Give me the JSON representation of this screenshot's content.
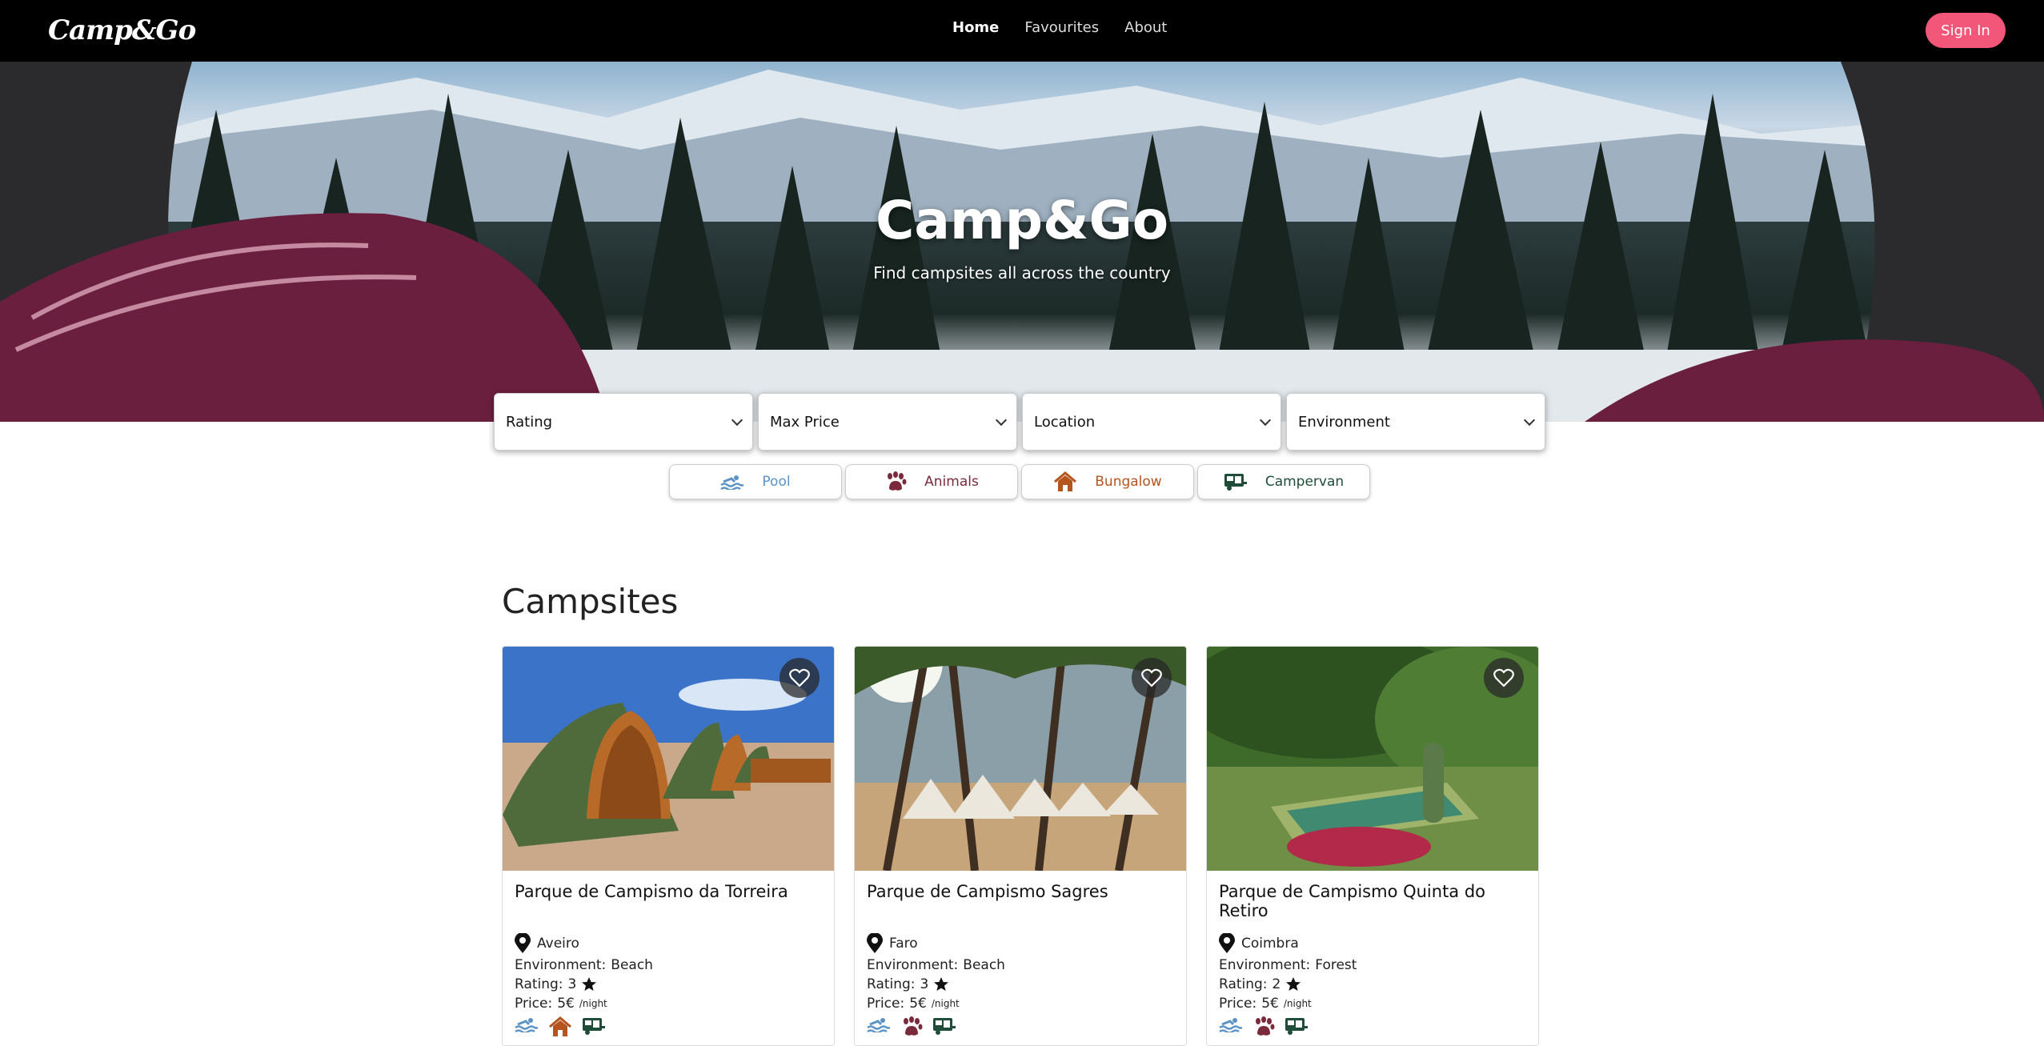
{
  "nav": {
    "logo": "Camp&Go",
    "links": [
      "Home",
      "Favourites",
      "About"
    ],
    "signin": "Sign In"
  },
  "hero": {
    "title": "Camp&Go",
    "subtitle": "Find campsites all across the country"
  },
  "filters": [
    "Rating",
    "Max Price",
    "Location",
    "Environment"
  ],
  "amenities": [
    {
      "label": "Pool",
      "icon": "pool-icon",
      "color": "#5b93c7"
    },
    {
      "label": "Animals",
      "icon": "paw-icon",
      "color": "#7a2a3a"
    },
    {
      "label": "Bungalow",
      "icon": "house-icon",
      "color": "#b5541d"
    },
    {
      "label": "Campervan",
      "icon": "campervan-icon",
      "color": "#1f4d3a"
    }
  ],
  "section_title": "Campsites",
  "labels": {
    "environment": "Environment:",
    "rating": "Rating:",
    "price": "Price:",
    "per_night": "/night"
  },
  "campsites": [
    {
      "name": "Parque de Campismo da Torreira",
      "location": "Aveiro",
      "environment": "Beach",
      "rating": "3",
      "price": "5€",
      "amenities": [
        "pool-icon",
        "house-icon",
        "campervan-icon"
      ]
    },
    {
      "name": "Parque de Campismo Sagres",
      "location": "Faro",
      "environment": "Beach",
      "rating": "3",
      "price": "5€",
      "amenities": [
        "pool-icon",
        "paw-icon",
        "campervan-icon"
      ]
    },
    {
      "name": "Parque de Campismo Quinta do Retiro",
      "location": "Coimbra",
      "environment": "Forest",
      "rating": "2",
      "price": "5€",
      "amenities": [
        "pool-icon",
        "paw-icon",
        "campervan-icon"
      ]
    }
  ],
  "colors": {
    "accent": "#f2577a",
    "navbar": "#000000"
  }
}
